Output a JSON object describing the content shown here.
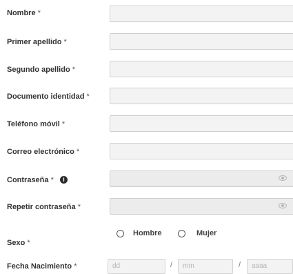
{
  "fields": [
    {
      "label": "Nombre",
      "required": "*"
    },
    {
      "label": "Primer apellido",
      "required": "*"
    },
    {
      "label": "Segundo apellido",
      "required": "*"
    },
    {
      "label": "Documento identidad",
      "required": "*"
    },
    {
      "label": "Teléfono móvil",
      "required": "*"
    },
    {
      "label": "Correo electrónico",
      "required": "*"
    },
    {
      "label": "Contraseña",
      "required": "*",
      "info_icon": "info-icon"
    },
    {
      "label": "Repetir contraseña",
      "required": "*"
    }
  ],
  "sexo": {
    "label": "Sexo",
    "required": "*",
    "options": [
      "Hombre",
      "Mujer"
    ]
  },
  "fecha": {
    "label": "Fecha Nacimiento",
    "required": "*",
    "placeholders": {
      "day": "dd",
      "month": "mm",
      "year": "aaaa"
    },
    "separator": "/"
  },
  "icons": {
    "password_toggle": "eye-icon",
    "info": "info-icon"
  },
  "info_glyph": "i"
}
